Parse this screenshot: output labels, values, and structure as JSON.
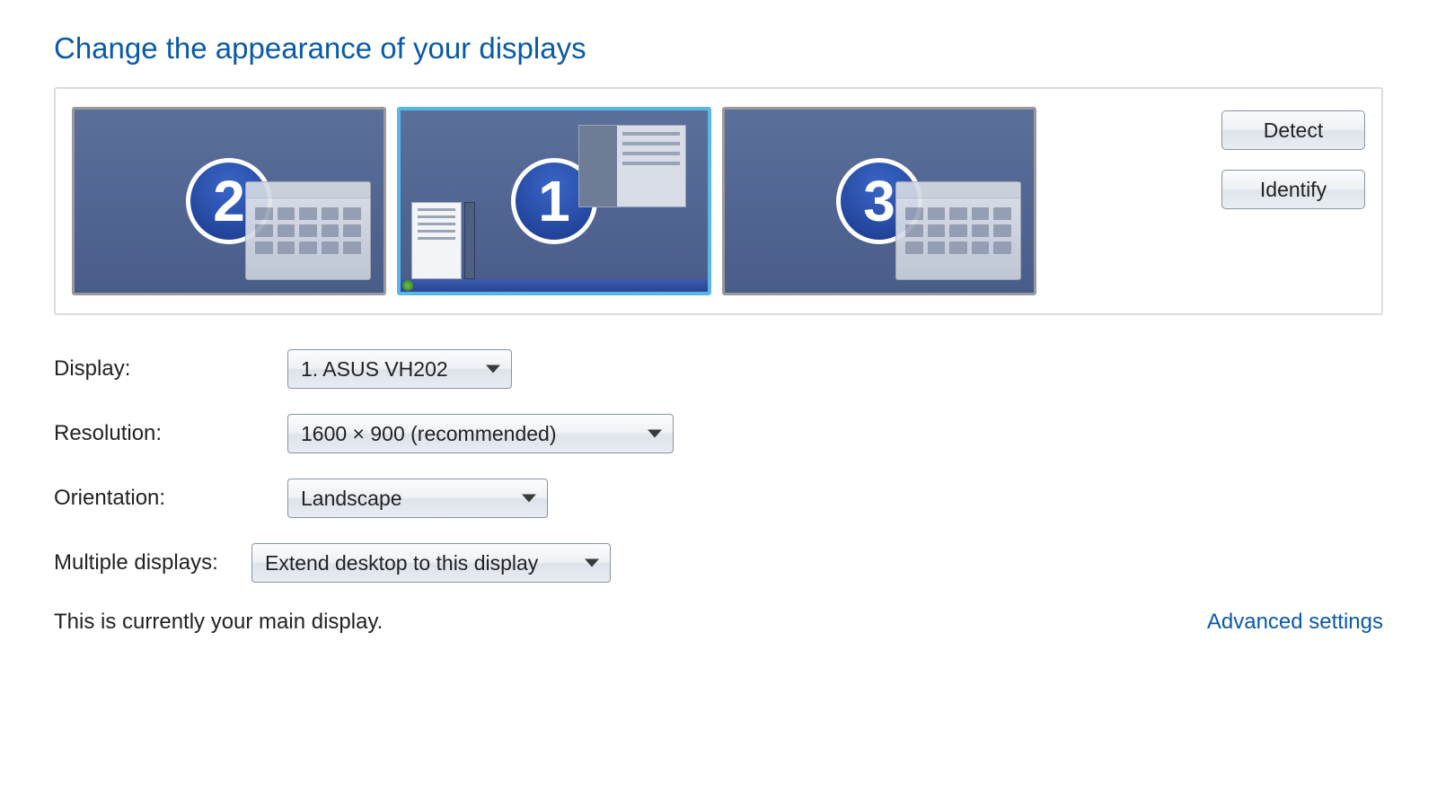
{
  "title": "Change the appearance of your displays",
  "monitors": [
    {
      "number": "2",
      "selected": false
    },
    {
      "number": "1",
      "selected": true
    },
    {
      "number": "3",
      "selected": false
    }
  ],
  "buttons": {
    "detect": "Detect",
    "identify": "Identify"
  },
  "form": {
    "display_label": "Display:",
    "display_value": "1. ASUS VH202",
    "resolution_label": "Resolution:",
    "resolution_value": "1600 × 900 (recommended)",
    "orientation_label": "Orientation:",
    "orientation_value": "Landscape",
    "multiple_label": "Multiple displays:",
    "multiple_value": "Extend desktop to this display"
  },
  "footer": {
    "main_display_note": "This is currently your main display.",
    "advanced_link": "Advanced settings"
  }
}
